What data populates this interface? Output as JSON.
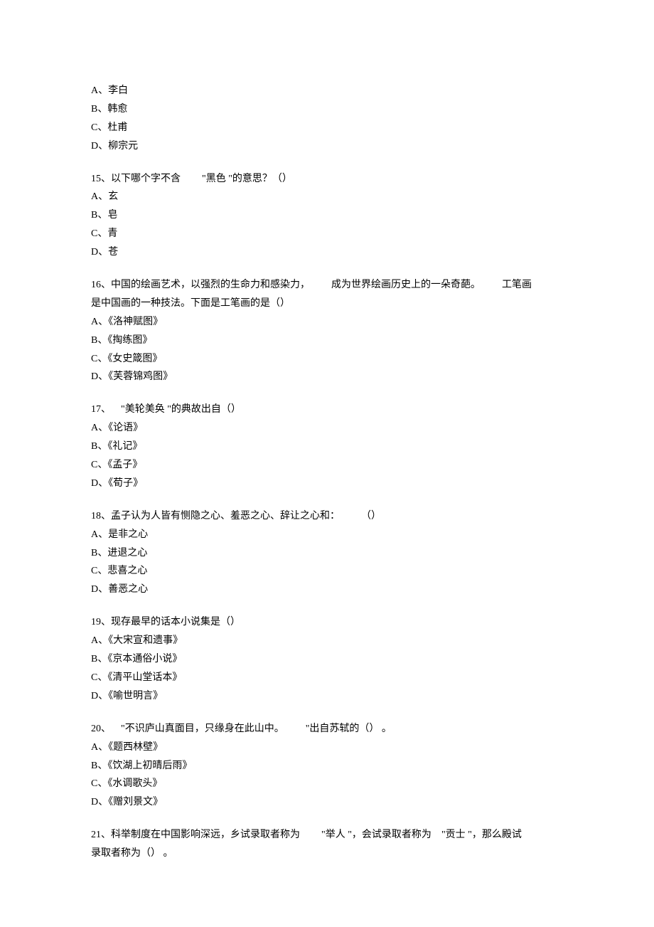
{
  "q14": {
    "options": {
      "a": "A、李白",
      "b": "B、韩愈",
      "c": "C、杜甫",
      "d": "D、柳宗元"
    }
  },
  "q15": {
    "stem_p1": "15、以下哪个字不含",
    "stem_p2": "\"黑色 \"的意思？（）",
    "options": {
      "a": "A、玄",
      "b": "B、皂",
      "c": "C、青",
      "d": "D、苍"
    }
  },
  "q16": {
    "stem_p1": "16、中国的绘画艺术，以强烈的生命力和感染力，",
    "stem_p2": "成为世界绘画历史上的一朵奇葩。",
    "stem_p3": "工笔画",
    "stem_p4": "是中国画的一种技法。下面是工笔画的是（）",
    "options": {
      "a": "A、《洛神赋图》",
      "b": "B、《掏练图》",
      "c": "C、《女史箴图》",
      "d": "D、《芙蓉锦鸡图》"
    }
  },
  "q17": {
    "stem_p1": "17、",
    "stem_p2": "\"美轮美奂 \"的典故出自（）",
    "options": {
      "a": "A、《论语》",
      "b": "B、《礼记》",
      "c": "C、《孟子》",
      "d": "D、《荀子》"
    }
  },
  "q18": {
    "stem_p1": "18、孟子认为人皆有恻隐之心、羞恶之心、辞让之心和：",
    "stem_p2": "（）",
    "options": {
      "a": "A、是非之心",
      "b": "B、进退之心",
      "c": "C、悲喜之心",
      "d": "D、善恶之心"
    }
  },
  "q19": {
    "stem": "19、现存最早的话本小说集是（）",
    "options": {
      "a": "A、《大宋宣和遗事》",
      "b": "B、《京本通俗小说》",
      "c": "C、《清平山堂话本》",
      "d": "D、《喻世明言》"
    }
  },
  "q20": {
    "stem_p1": "20、",
    "stem_p2": "\"不识庐山真面目，只缘身在此山中。",
    "stem_p3": "\"出自苏轼的（） 。",
    "options": {
      "a": "A、《题西林壁》",
      "b": "B、《饮湖上初晴后雨》",
      "c": "C、《水调歌头》",
      "d": "D、《赠刘景文》"
    }
  },
  "q21": {
    "stem_p1": "21、科举制度在中国影响深远，乡试录取者称为",
    "stem_p2": "\"举人 \"，会试录取者称为",
    "stem_p3": "\"贡士 \"，那么殿试",
    "stem_p4": "录取者称为（） 。"
  }
}
